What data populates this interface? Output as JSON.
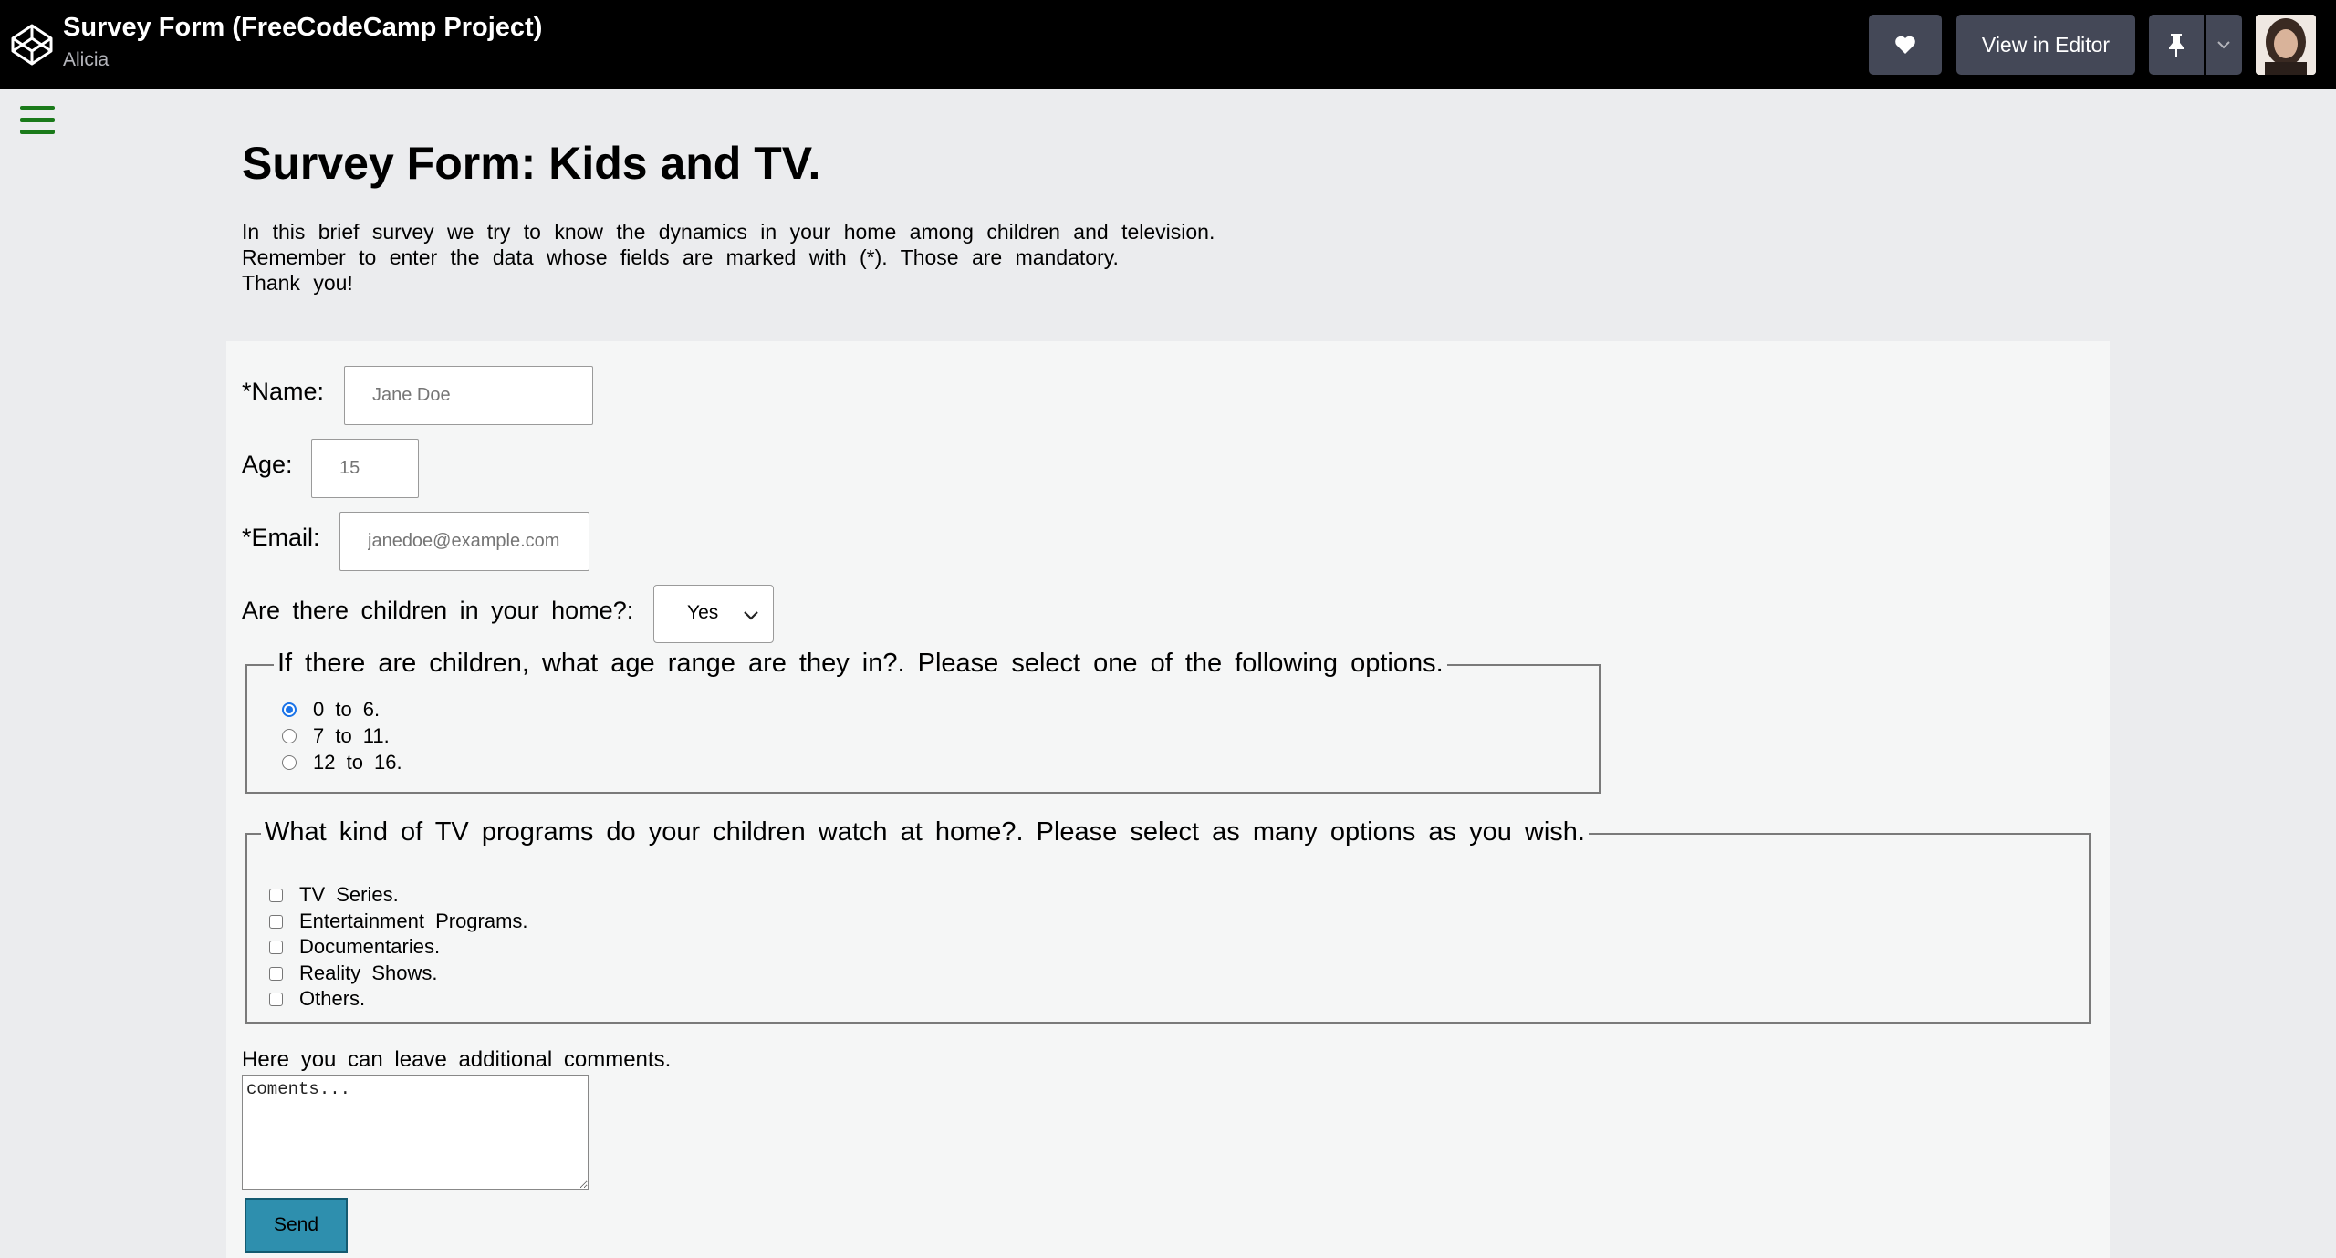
{
  "topbar": {
    "title": "Survey Form (FreeCodeCamp Project)",
    "author": "Alicia",
    "view_in_editor_label": "View in Editor",
    "heart_icon": "heart-icon",
    "pin_icon": "pin-icon"
  },
  "page": {
    "title": "Survey Form: Kids and TV.",
    "intro_lines": [
      "In this brief survey we try to know the dynamics in your home among children and television.",
      "Remember to enter the data whose fields are marked with (*). Those are mandatory.",
      "Thank you!"
    ]
  },
  "form": {
    "name_label": "*Name:",
    "name_placeholder": "Jane Doe",
    "age_label": "Age:",
    "age_placeholder": "15",
    "email_label": "*Email:",
    "email_placeholder": "janedoe@example.com",
    "children_label": "Are there children in your home?:",
    "children_selected": "Yes",
    "age_range_legend": "If there are children, what age range are they in?. Please select one of the following options.",
    "age_ranges": [
      "0 to 6.",
      "7 to 11.",
      "12 to 16."
    ],
    "age_range_selected": "0 to 6.",
    "programs_legend": "What kind of TV programs do your children watch at home?. Please select as many options as you wish.",
    "programs": [
      "TV Series.",
      "Entertainment Programs.",
      "Documentaries.",
      "Reality Shows.",
      "Others."
    ],
    "comments_label": "Here you can leave additional comments.",
    "comments_placeholder": "coments...",
    "send_label": "Send"
  },
  "colors": {
    "topbar_bg": "#000000",
    "button_bg": "#444857",
    "page_bg": "#ebecee",
    "form_bg": "#f5f6f6",
    "send_button": "#2e8fae",
    "hamburger": "#1a7a1a",
    "radio_checked": "#1a73e8"
  }
}
